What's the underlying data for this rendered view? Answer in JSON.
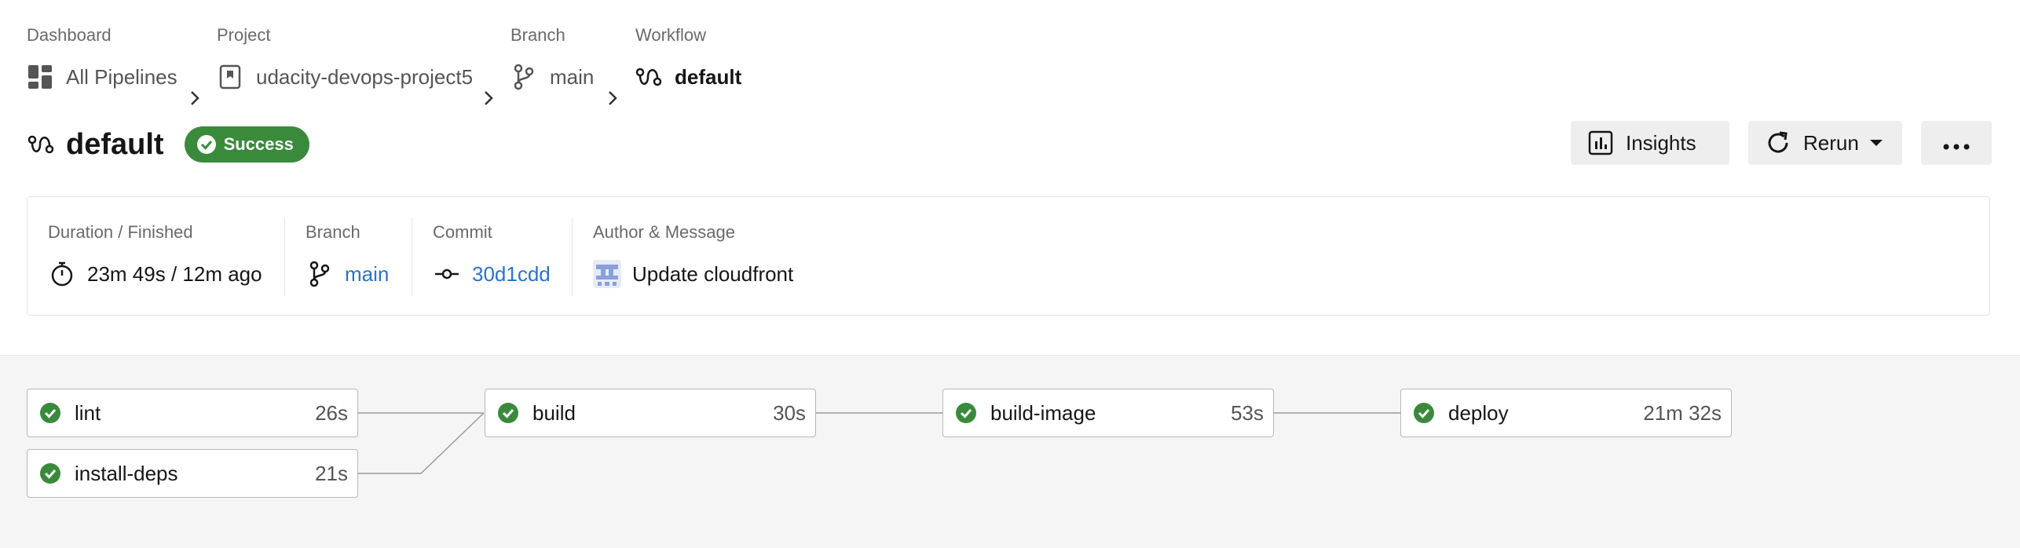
{
  "breadcrumb": {
    "items": [
      {
        "label": "Dashboard",
        "text": "All Pipelines",
        "icon": "dashboard-icon"
      },
      {
        "label": "Project",
        "text": "udacity-devops-project5",
        "icon": "project-icon"
      },
      {
        "label": "Branch",
        "text": "main",
        "icon": "branch-icon"
      },
      {
        "label": "Workflow",
        "text": "default",
        "icon": "workflow-icon"
      }
    ]
  },
  "title": {
    "text": "default",
    "status": "Success",
    "status_color": "#3a8a3c"
  },
  "actions": {
    "insights": "Insights",
    "rerun": "Rerun",
    "more": "..."
  },
  "info": {
    "duration_label": "Duration / Finished",
    "duration_value": "23m 49s / 12m ago",
    "branch_label": "Branch",
    "branch_value": "main",
    "commit_label": "Commit",
    "commit_value": "30d1cdd",
    "author_label": "Author & Message",
    "author_message": "Update cloudfront",
    "link_color": "#2a73c7"
  },
  "jobs": [
    {
      "name": "lint",
      "duration": "26s",
      "status": "success"
    },
    {
      "name": "install-deps",
      "duration": "21s",
      "status": "success"
    },
    {
      "name": "build",
      "duration": "30s",
      "status": "success"
    },
    {
      "name": "build-image",
      "duration": "53s",
      "status": "success"
    },
    {
      "name": "deploy",
      "duration": "21m 32s",
      "status": "success"
    }
  ]
}
